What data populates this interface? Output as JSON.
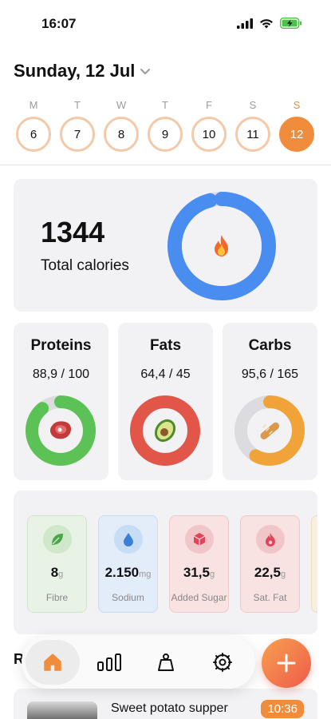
{
  "status_bar": {
    "time": "16:07"
  },
  "header": {
    "date_title": "Sunday, 12 Jul"
  },
  "week": [
    {
      "letter": "M",
      "day": "6",
      "active": false
    },
    {
      "letter": "T",
      "day": "7",
      "active": false
    },
    {
      "letter": "W",
      "day": "8",
      "active": false
    },
    {
      "letter": "T",
      "day": "9",
      "active": false
    },
    {
      "letter": "F",
      "day": "10",
      "active": false
    },
    {
      "letter": "S",
      "day": "11",
      "active": false
    },
    {
      "letter": "S",
      "day": "12",
      "active": true
    }
  ],
  "calories": {
    "value": "1344",
    "label": "Total calories",
    "icon": "fire-icon",
    "ring_progress": 0.96,
    "ring_color": "#4a8df0"
  },
  "macros": [
    {
      "title": "Proteins",
      "value": "88,9 / 100",
      "icon": "steak-icon",
      "progress": 0.889,
      "color": "#5cc255"
    },
    {
      "title": "Fats",
      "value": "64,4 / 45",
      "icon": "avocado-icon",
      "progress": 1.0,
      "color": "#e2564a"
    },
    {
      "title": "Carbs",
      "value": "95,6 / 165",
      "icon": "bread-icon",
      "progress": 0.58,
      "color": "#f0a338"
    }
  ],
  "micros": [
    {
      "amount": "8",
      "unit": "g",
      "label": "Fibre",
      "icon": "leaf-icon",
      "bg": "#e8f3e6",
      "border": "#cfe6cb",
      "icon_bg": "#cfe8c9",
      "icon_color": "#4aa64a"
    },
    {
      "amount": "2.150",
      "unit": "mg",
      "label": "Sodium",
      "icon": "water-drop-icon",
      "bg": "#e3edf9",
      "border": "#c8dcf3",
      "icon_bg": "#c7dcf5",
      "icon_color": "#3a7fd8"
    },
    {
      "amount": "31,5",
      "unit": "g",
      "label": "Added Sugar",
      "icon": "cube-icon",
      "bg": "#f8e2e2",
      "border": "#efcaca",
      "icon_bg": "#f1c6c8",
      "icon_color": "#e0445a"
    },
    {
      "amount": "22,5",
      "unit": "g",
      "label": "Sat. Fat",
      "icon": "flame-drop-icon",
      "bg": "#f8e2e2",
      "border": "#efcaca",
      "icon_bg": "#f1c6c8",
      "icon_color": "#e0445a"
    }
  ],
  "recent": {
    "heading": "Recent"
  },
  "meal": {
    "name": "Sweet potato supper",
    "time": "10:36"
  },
  "colors": {
    "accent": "#f08d3c",
    "calories_ring": "#4a8df0"
  }
}
